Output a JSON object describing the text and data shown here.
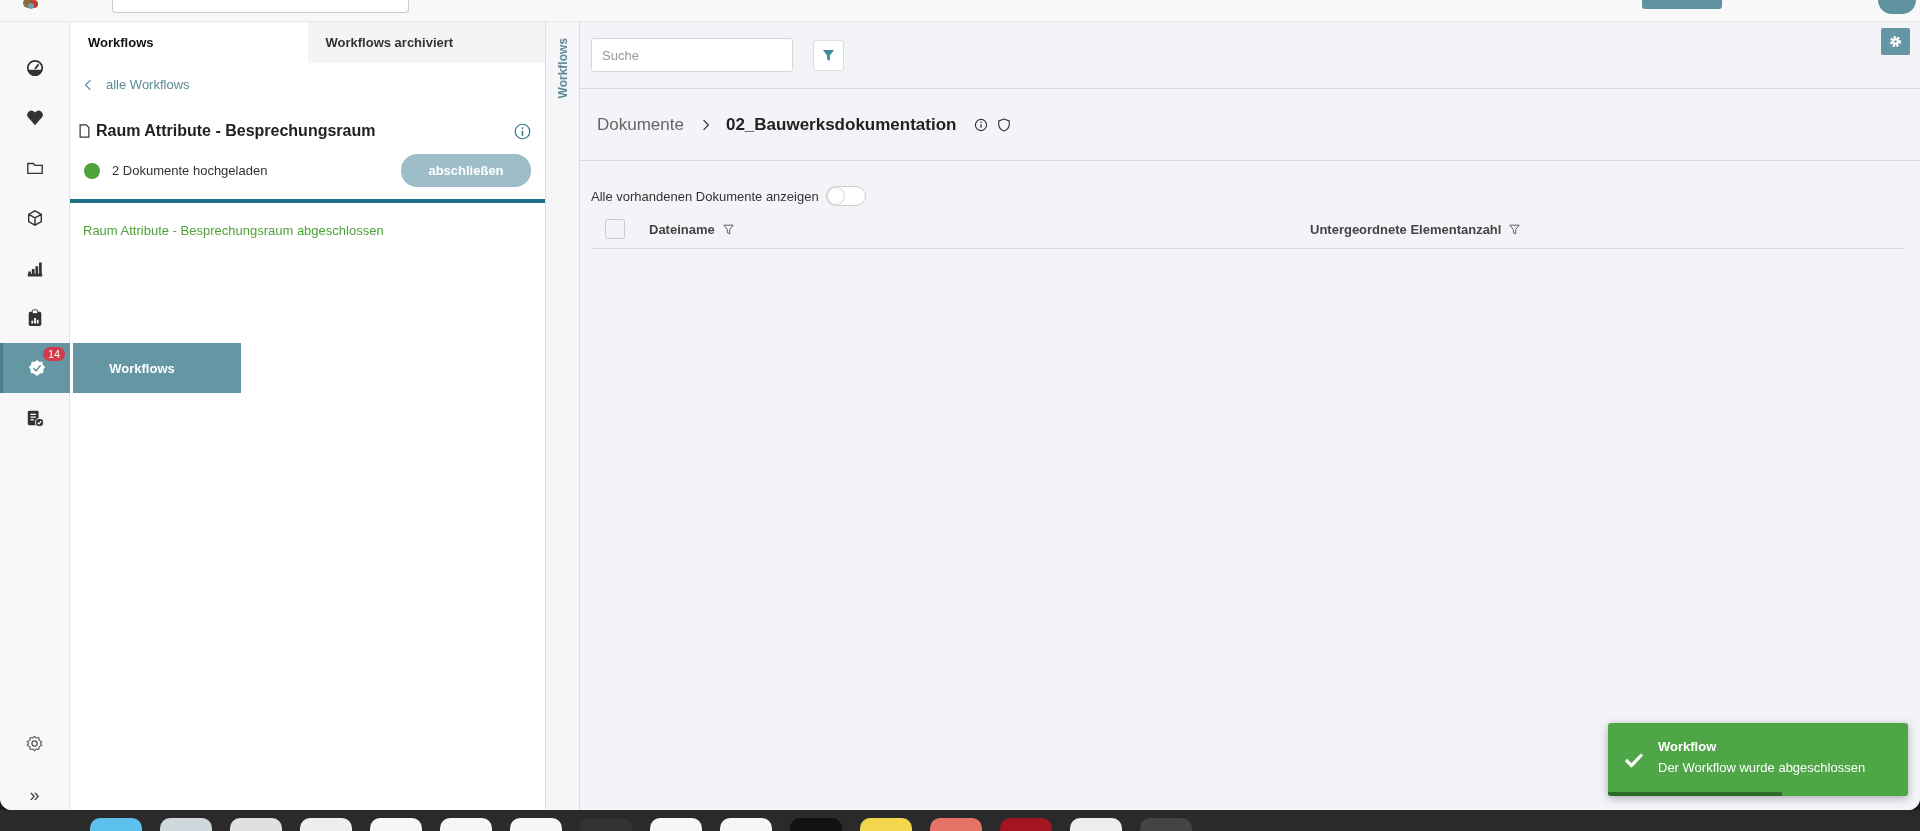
{
  "sidebar": {
    "items": [
      {
        "selected": false
      },
      {
        "selected": false
      },
      {
        "selected": false
      },
      {
        "selected": false
      },
      {
        "selected": false
      },
      {
        "selected": false
      },
      {
        "selected": true,
        "badge": "14",
        "tooltip": "Workflows"
      },
      {
        "selected": false
      }
    ],
    "footer": {
      "expand": "»"
    }
  },
  "panel": {
    "tabs": [
      {
        "label": "Workflows",
        "selected": true
      },
      {
        "label": "Workflows archiviert",
        "selected": false
      }
    ],
    "back_link": "alle Workflows",
    "workflow": {
      "title": "Raum Attribute - Besprechungsraum",
      "status": "2 Dokumente hochgeladen",
      "button": {
        "label": "abschließen",
        "disabled": true
      },
      "message": "Raum Attribute - Besprechungsraum abgeschlossen"
    }
  },
  "side_strip": {
    "label": "Workflows"
  },
  "main": {
    "search": {
      "placeholder": "Suche"
    },
    "breadcrumb": [
      "Dokumente",
      "02_Bauwerksdokumentation"
    ],
    "toggle": {
      "label": "Alle vorhandenen Dokumente anzeigen",
      "on": false
    },
    "table": {
      "select_all_checked": false,
      "columns": [
        {
          "label": "Dateiname"
        },
        {
          "label": "Untergeordnete Elementanzahl"
        }
      ]
    }
  },
  "toast": {
    "title": "Workflow",
    "message": "Der Workflow wurde abgeschlossen",
    "level": 0.58
  }
}
